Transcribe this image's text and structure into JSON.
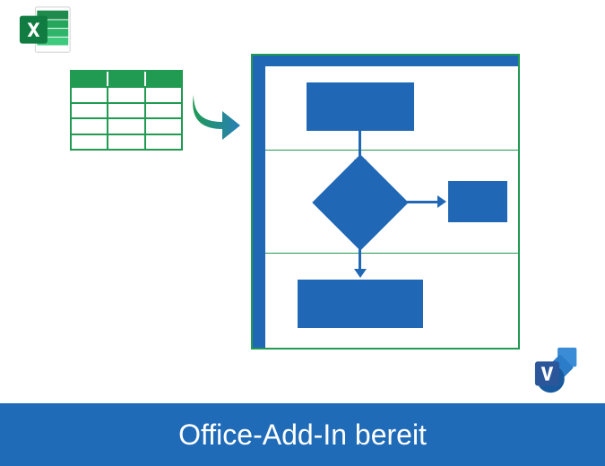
{
  "footer": {
    "text": "Office-Add-In bereit"
  },
  "icons": {
    "excel": "excel-icon",
    "visio": "visio-icon",
    "arrow": "arrow-icon"
  },
  "colors": {
    "green": "#219a52",
    "blue": "#2068b5",
    "footer_blue": "#1f6bb8"
  }
}
